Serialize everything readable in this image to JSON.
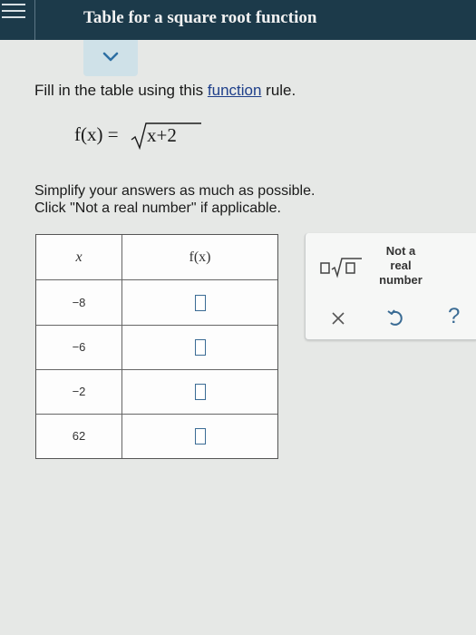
{
  "header": {
    "title": "Table for a square root function"
  },
  "instruction": {
    "prefix": "Fill in the table using this ",
    "link": "function",
    "suffix": " rule."
  },
  "formula": {
    "lhs": "f(x) =",
    "radicand": "x+2"
  },
  "simplify": {
    "line1": "Simplify your answers as much as possible.",
    "line2": "Click \"Not a real number\" if applicable."
  },
  "table": {
    "headers": [
      "x",
      "f(x)"
    ],
    "rows": [
      {
        "x": "−8"
      },
      {
        "x": "−6"
      },
      {
        "x": "−2"
      },
      {
        "x": "62"
      }
    ]
  },
  "keypad": {
    "not_real": [
      "Not a",
      "real",
      "number"
    ],
    "clear_symbol": "×",
    "help_symbol": "?"
  },
  "colors": {
    "header_bg": "#1c3a4a",
    "accent": "#3a6b94",
    "tab_bg": "#cfe1e8"
  },
  "icons": [
    "hamburger-icon",
    "chevron-down-icon",
    "square-root-icon",
    "close-icon",
    "undo-icon",
    "help-icon"
  ]
}
